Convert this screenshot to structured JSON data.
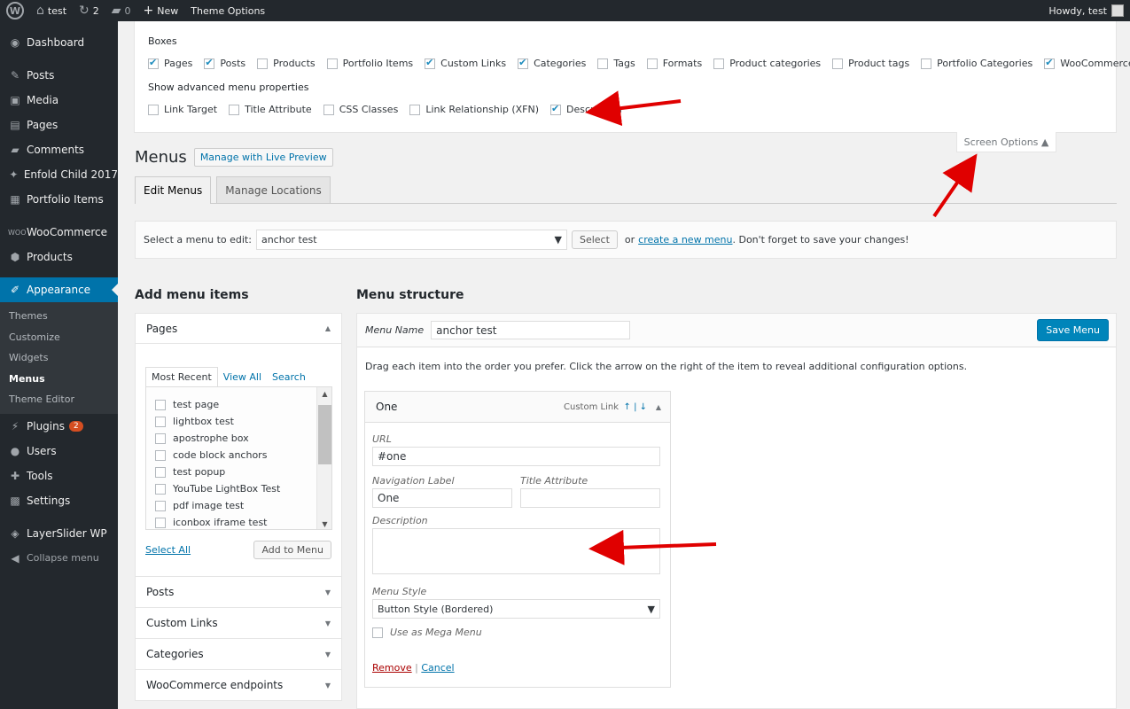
{
  "adminbar": {
    "site_name": "test",
    "updates_count": "2",
    "comments_count": "0",
    "new_label": "New",
    "theme_options_label": "Theme Options",
    "howdy": "Howdy, test"
  },
  "sidebar": {
    "items": [
      {
        "label": "Dashboard",
        "icon": "dashboard-icon"
      },
      {
        "label": "Posts",
        "icon": "pin-icon"
      },
      {
        "label": "Media",
        "icon": "media-icon"
      },
      {
        "label": "Pages",
        "icon": "pages-icon"
      },
      {
        "label": "Comments",
        "icon": "comment-icon"
      },
      {
        "label": "Enfold Child 2017",
        "icon": "enfold-icon"
      },
      {
        "label": "Portfolio Items",
        "icon": "portfolio-icon"
      },
      {
        "label": "WooCommerce",
        "icon": "woo-icon"
      },
      {
        "label": "Products",
        "icon": "box-icon"
      },
      {
        "label": "Appearance",
        "icon": "brush-icon"
      },
      {
        "label": "Plugins",
        "icon": "plug-icon",
        "badge": "2"
      },
      {
        "label": "Users",
        "icon": "user-icon"
      },
      {
        "label": "Tools",
        "icon": "wrench-icon"
      },
      {
        "label": "Settings",
        "icon": "settings-icon"
      },
      {
        "label": "LayerSlider WP",
        "icon": "layers-icon"
      },
      {
        "label": "Collapse menu",
        "icon": "collapse-icon"
      }
    ],
    "submenu": [
      "Themes",
      "Customize",
      "Widgets",
      "Menus",
      "Theme Editor"
    ]
  },
  "screen_options": {
    "boxes_label": "Boxes",
    "boxes": [
      {
        "label": "Pages",
        "checked": true
      },
      {
        "label": "Posts",
        "checked": true
      },
      {
        "label": "Products",
        "checked": false
      },
      {
        "label": "Portfolio Items",
        "checked": false
      },
      {
        "label": "Custom Links",
        "checked": true
      },
      {
        "label": "Categories",
        "checked": true
      },
      {
        "label": "Tags",
        "checked": false
      },
      {
        "label": "Formats",
        "checked": false
      },
      {
        "label": "Product categories",
        "checked": false
      },
      {
        "label": "Product tags",
        "checked": false
      },
      {
        "label": "Portfolio Categories",
        "checked": false
      },
      {
        "label": "WooCommerce endpoints",
        "checked": true
      }
    ],
    "advanced_label": "Show advanced menu properties",
    "advanced": [
      {
        "label": "Link Target",
        "checked": false
      },
      {
        "label": "Title Attribute",
        "checked": false
      },
      {
        "label": "CSS Classes",
        "checked": false
      },
      {
        "label": "Link Relationship (XFN)",
        "checked": false
      },
      {
        "label": "Description",
        "checked": true
      }
    ],
    "tab_label": "Screen Options ▲"
  },
  "page": {
    "title": "Menus",
    "live_preview": "Manage with Live Preview",
    "tabs": [
      "Edit Menus",
      "Manage Locations"
    ]
  },
  "select_bar": {
    "label": "Select a menu to edit:",
    "selected": "anchor test",
    "button": "Select",
    "or": "or",
    "create_link": "create a new menu",
    "suffix": ". Don't forget to save your changes!"
  },
  "add_items": {
    "title": "Add menu items",
    "pages_label": "Pages",
    "tabs": [
      "Most Recent",
      "View All",
      "Search"
    ],
    "pages": [
      "test page",
      "lightbox test",
      "apostrophe box",
      "code block anchors",
      "test popup",
      "YouTube LightBox Test",
      "pdf image test",
      "iconbox iframe test"
    ],
    "select_all": "Select All",
    "add_button": "Add to Menu",
    "other_sections": [
      "Posts",
      "Custom Links",
      "Categories",
      "WooCommerce endpoints"
    ]
  },
  "menu_structure": {
    "title": "Menu structure",
    "name_label": "Menu Name",
    "name_value": "anchor test",
    "save_button": "Save Menu",
    "instructions": "Drag each item into the order you prefer. Click the arrow on the right of the item to reveal additional configuration options.",
    "item": {
      "title": "One",
      "type": "Custom Link",
      "controls": "↑ | ↓",
      "url_label": "URL",
      "url_value": "#one",
      "nav_label": "Navigation Label",
      "nav_value": "One",
      "title_attr_label": "Title Attribute",
      "desc_label": "Description",
      "style_label": "Menu Style",
      "style_value": "Button Style (Bordered)",
      "mega_label": "Use as Mega Menu",
      "remove": "Remove",
      "cancel": "Cancel"
    }
  },
  "colors": {
    "admin_dark": "#23282d",
    "accent": "#0073aa",
    "annotation_arrow": "#e00000"
  }
}
